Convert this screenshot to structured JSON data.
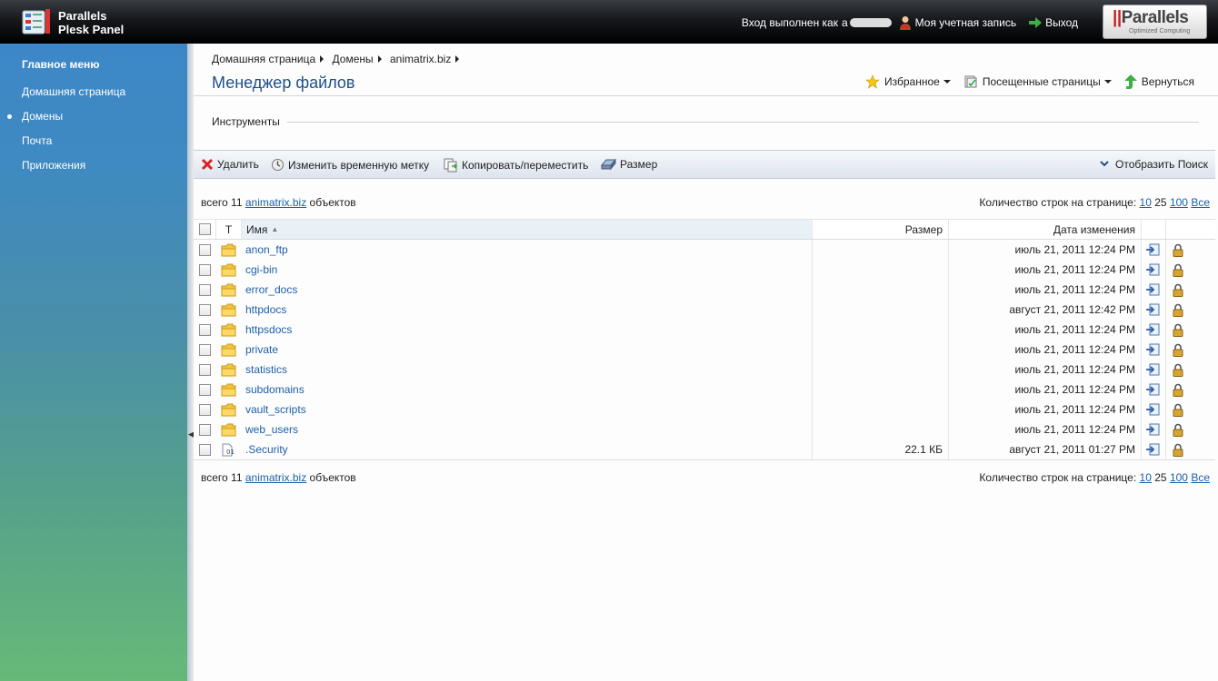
{
  "header": {
    "brand_line1": "Parallels",
    "brand_line2": "Plesk Panel",
    "logged_in_label": "Вход выполнен как",
    "logged_in_user_visible": "а",
    "account_label": "Моя учетная запись",
    "logout_label": "Выход",
    "badge_name_prefix": "||",
    "badge_name": "Parallels",
    "badge_sub": "Optimized Computing"
  },
  "sidebar": {
    "title": "Главное меню",
    "items": [
      {
        "label": "Домашняя страница",
        "active": false
      },
      {
        "label": "Домены",
        "active": true
      },
      {
        "label": "Почта",
        "active": false
      },
      {
        "label": "Приложения",
        "active": false
      }
    ]
  },
  "breadcrumbs": [
    "Домашняя страница",
    "Домены",
    "animatrix.biz"
  ],
  "page_title": "Менеджер файлов",
  "top_links": {
    "favorites": "Избранное",
    "visited": "Посещенные страницы",
    "back": "Вернуться"
  },
  "tools_label": "Инструменты",
  "toolbar": {
    "delete": "Удалить",
    "change_timestamp": "Изменить временную метку",
    "copy_move": "Копировать/переместить",
    "size": "Размер",
    "show_search": "Отобразить Поиск"
  },
  "summary": {
    "prefix": "всего 11",
    "domain": "animatrix.biz",
    "suffix": "объектов",
    "rows_per_page_label": "Количество строк на странице:",
    "page_sizes": [
      "10",
      "25",
      "100",
      "Все"
    ]
  },
  "table": {
    "headers": {
      "type": "Т",
      "name": "Имя",
      "size": "Размер",
      "date": "Дата изменения"
    },
    "rows": [
      {
        "name": "anon_ftp",
        "size": "",
        "date": "июль 21, 2011 12:24 PM",
        "kind": "folder"
      },
      {
        "name": "cgi-bin",
        "size": "",
        "date": "июль 21, 2011 12:24 PM",
        "kind": "folder"
      },
      {
        "name": "error_docs",
        "size": "",
        "date": "июль 21, 2011 12:24 PM",
        "kind": "folder"
      },
      {
        "name": "httpdocs",
        "size": "",
        "date": "август 21, 2011 12:42 PM",
        "kind": "folder"
      },
      {
        "name": "httpsdocs",
        "size": "",
        "date": "июль 21, 2011 12:24 PM",
        "kind": "folder"
      },
      {
        "name": "private",
        "size": "",
        "date": "июль 21, 2011 12:24 PM",
        "kind": "folder"
      },
      {
        "name": "statistics",
        "size": "",
        "date": "июль 21, 2011 12:24 PM",
        "kind": "folder"
      },
      {
        "name": "subdomains",
        "size": "",
        "date": "июль 21, 2011 12:24 PM",
        "kind": "folder"
      },
      {
        "name": "vault_scripts",
        "size": "",
        "date": "июль 21, 2011 12:24 PM",
        "kind": "folder"
      },
      {
        "name": "web_users",
        "size": "",
        "date": "июль 21, 2011 12:24 PM",
        "kind": "folder"
      },
      {
        "name": ".Security",
        "size": "22.1 КБ",
        "date": "август 21, 2011 01:27 PM",
        "kind": "file"
      }
    ]
  }
}
